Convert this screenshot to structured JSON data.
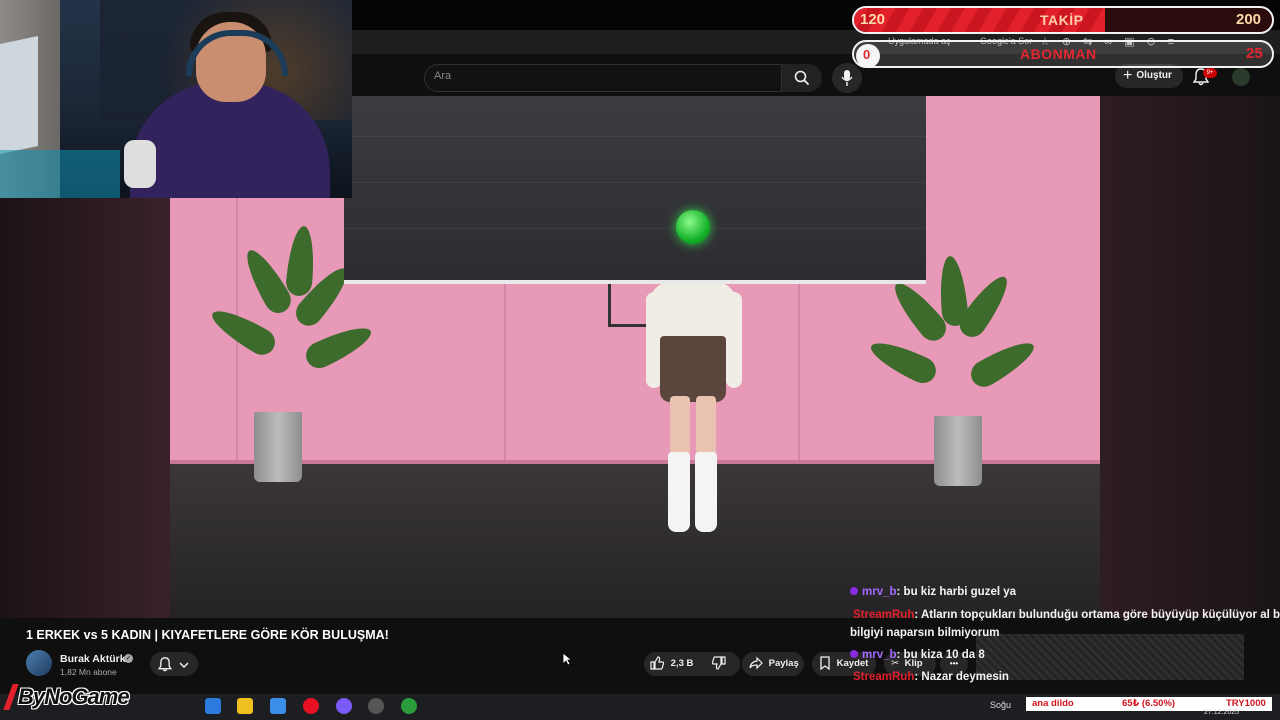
{
  "browser": {
    "bookmarks": [
      "Uygulamada aç",
      "Google'a Sor"
    ]
  },
  "youtube": {
    "search_placeholder": "Ara",
    "create_label": "Oluştur",
    "notif_badge": "9+",
    "video_title": "1 ERKEK vs 5 KADIN | KIYAFETLERE GÖRE KÖR BULUŞMA!",
    "channel_name": "Burak Aktürk",
    "channel_subs": "1,82 Mn abone",
    "like_count": "2,3 B",
    "share_label": "Paylaş",
    "save_label": "Kaydet",
    "clip_label": "Klip",
    "more_label": "•••"
  },
  "overlay": {
    "follow": {
      "current": "120",
      "label": "TAKİP",
      "goal": "200",
      "progress": 0.6
    },
    "subscriber": {
      "current": "0",
      "label": "ABONMAN",
      "goal": "25",
      "progress": 0.0
    }
  },
  "chat": [
    {
      "user": "mrv_b",
      "text": ": bu kiz harbi guzel ya",
      "user_color": "purple"
    },
    {
      "user": "StreamRuh",
      "text": ": Atların topçukları bulunduğu ortama göre büyüyüp küçülüyor al bu",
      "user_color": "red"
    },
    {
      "user": "",
      "text": "bilgiyi naparsın bilmiyorum",
      "user_color": "none"
    },
    {
      "user": "mrv_b",
      "text": ": bu kiza 10 da 8",
      "user_color": "purple"
    },
    {
      "user": "StreamRuh",
      "text": ": Nazar deymesin",
      "user_color": "red"
    }
  ],
  "taskbar": {
    "logo_text": "ByNoGame",
    "weather": "Soğu",
    "ticker_left": "ana dildo",
    "ticker_mid": "65₺ (6.50%)",
    "ticker_right": "TRY1000",
    "date": "27.12.2025"
  },
  "colors": {
    "accent_red": "#e3212b",
    "youtube_bg": "#0f0f0f",
    "chat_purple": "#a46bff"
  }
}
